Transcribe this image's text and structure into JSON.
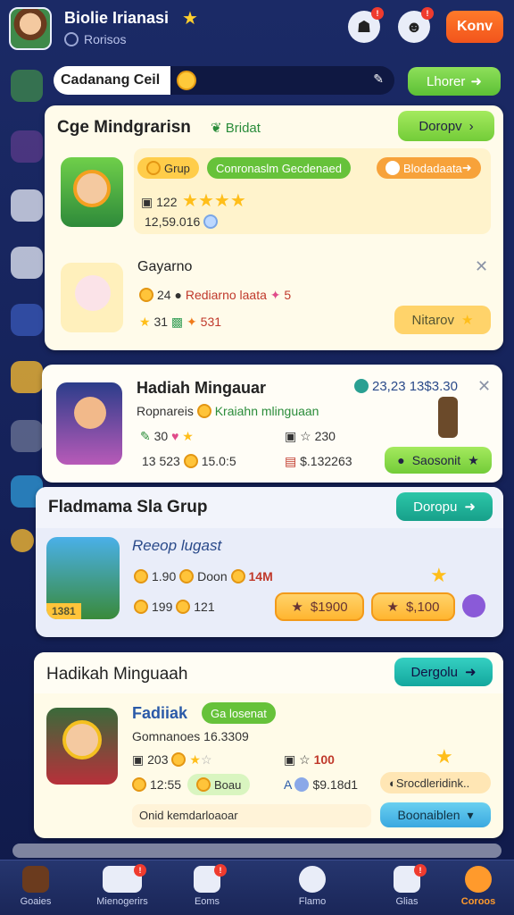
{
  "header": {
    "player_name": "Biolie Irianasi",
    "player_sub": "Rorisos",
    "kbtn_label": "Konv"
  },
  "search": {
    "label": "Cadanang Ceil",
    "button_label": "Lhorer"
  },
  "card1": {
    "title": "Cge Mindgrarisn",
    "subtitle": "Bridat",
    "button": "Doropv",
    "row1": {
      "tags": [
        "Grup",
        "Conronaslm Gecdenaed",
        "Blodadaata"
      ],
      "stat1": "122",
      "stat2": "12,59.016"
    },
    "row2": {
      "name": "Gayarno",
      "s1": "24",
      "s2": "Rediarno laata",
      "s3": "5",
      "s4": "31",
      "s5": "531",
      "button": "Nitarov"
    }
  },
  "card2": {
    "title": "Hadiah Mingauar",
    "meta": "23,23 13$3.30",
    "sub1": "Ropnareis",
    "sub2": "Kraiahn mlinguaan",
    "s1": "30",
    "s2": "230",
    "s3": "13 523",
    "s4": "15.0:5",
    "s5": "$.132263",
    "button": "Saosonit"
  },
  "card3": {
    "title": "Fladmama Sla Grup",
    "button": "Doropu",
    "heading": "Reeop lugast",
    "s1": "1.90",
    "s2": "Doon",
    "s3": "14M",
    "s4": "199",
    "s5": "121",
    "price1": "$1900",
    "price2": "$,100",
    "thumb_label": "1381"
  },
  "card4": {
    "title": "Hadikah Minguaah",
    "button": "Dergolu",
    "name": "Fadiiak",
    "tag": "Ga losenat",
    "sub": "Gomnanoes 16.3309",
    "s1": "203",
    "s2": "100",
    "s3": "12:55",
    "s4": "Boau",
    "s5": "$9.18d1",
    "s6": "Srocdleridink..",
    "input_ph": "Onid kemdarloaoar",
    "button2": "Boonaiblen"
  },
  "nav": {
    "items": [
      "Goaies",
      "Mienogerirs",
      "Eoms",
      "Flamo",
      "Glias",
      "Coroos"
    ]
  },
  "colors": {
    "accent": "#f2541c",
    "green": "#73cc38",
    "teal": "#17a08a",
    "bg": "#1b2a66"
  }
}
